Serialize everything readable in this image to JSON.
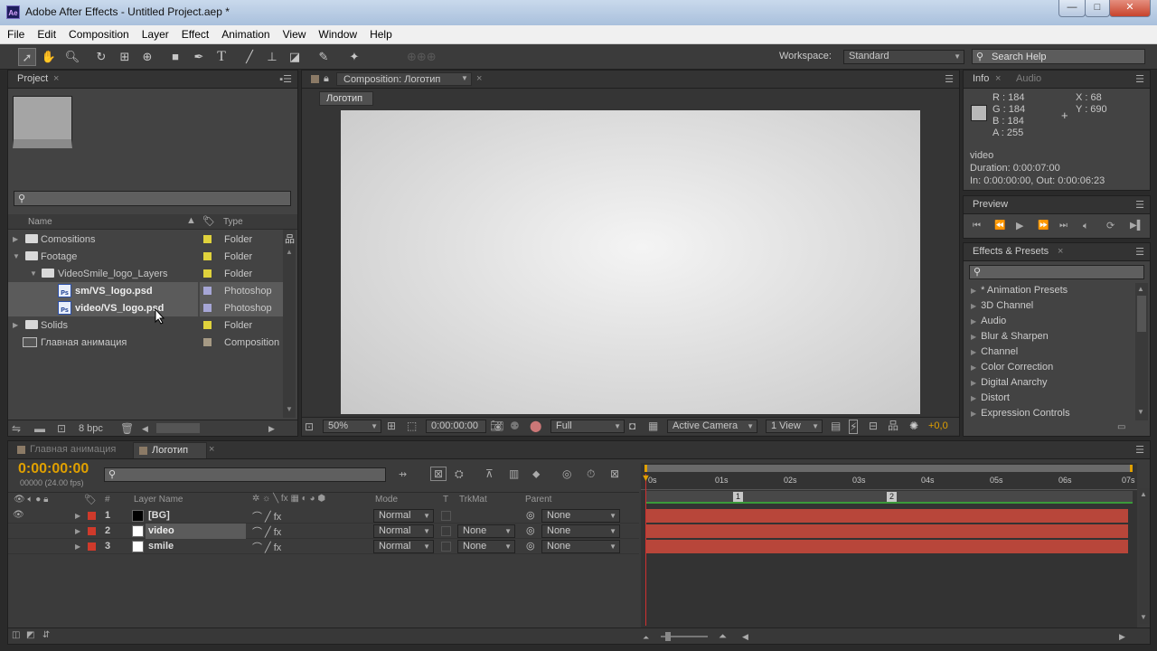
{
  "window": {
    "app_icon": "Ae",
    "title": "Adobe After Effects - Untitled Project.aep *",
    "min": "—",
    "max": "□",
    "close": "✕"
  },
  "menu": [
    "File",
    "Edit",
    "Composition",
    "Layer",
    "Effect",
    "Animation",
    "View",
    "Window",
    "Help"
  ],
  "toolbar": {
    "workspace_label": "Workspace:",
    "workspace_value": "Standard",
    "search_help": "Search Help"
  },
  "project": {
    "tab": "Project",
    "col_name": "Name",
    "col_type": "Type",
    "items": [
      {
        "name": "Comositions",
        "type": "Folder",
        "swatch": "#e0d23c"
      },
      {
        "name": "Footage",
        "type": "Folder",
        "swatch": "#e0d23c"
      },
      {
        "name": "VideoSmile_logo_Layers",
        "type": "Folder",
        "swatch": "#e0d23c"
      },
      {
        "name": "sm/VS_logo.psd",
        "type": "Photoshop",
        "swatch": "#a6a6d6"
      },
      {
        "name": "video/VS_logo.psd",
        "type": "Photoshop",
        "swatch": "#a6a6d6"
      },
      {
        "name": "Solids",
        "type": "Folder",
        "swatch": "#e0d23c"
      },
      {
        "name": "Главная анимация",
        "type": "Composition",
        "swatch": "#a69a85"
      }
    ],
    "bpc": "8 bpc"
  },
  "composition": {
    "tab": "Composition: Логотип",
    "sub_tab": "Логотип",
    "zoom": "50%",
    "timecode": "0:00:00:00",
    "resolution": "Full",
    "camera": "Active Camera",
    "view": "1 View",
    "exposure": "+0,0"
  },
  "info": {
    "tab": "Info",
    "tab2": "Audio",
    "r": "R : 184",
    "g": "G : 184",
    "b": "B : 184",
    "a": "A : 255",
    "x": "X : 68",
    "y": "Y : 690",
    "name": "video",
    "duration": "Duration: 0:00:07:00",
    "inout": "In: 0:00:00:00, Out: 0:00:06:23"
  },
  "preview": {
    "tab": "Preview"
  },
  "effects": {
    "tab": "Effects & Presets",
    "items": [
      "* Animation Presets",
      "3D Channel",
      "Audio",
      "Blur & Sharpen",
      "Channel",
      "Color Correction",
      "Digital Anarchy",
      "Distort",
      "Expression Controls"
    ]
  },
  "timeline": {
    "tab1": "Главная анимация",
    "tab2": "Логотип",
    "timecode": "0:00:00:00",
    "fps": "00000 (24.00 fps)",
    "cols": {
      "num": "#",
      "layer_name": "Layer Name",
      "mode": "Mode",
      "t": "T",
      "trkmat": "TrkMat",
      "parent": "Parent"
    },
    "layers": [
      {
        "num": "1",
        "name": "[BG]",
        "mode": "Normal",
        "trkmat": "",
        "parent": "None",
        "swatch": "#000000"
      },
      {
        "num": "2",
        "name": "video",
        "mode": "Normal",
        "trkmat": "None",
        "parent": "None",
        "swatch": "#ffffff"
      },
      {
        "num": "3",
        "name": "smile",
        "mode": "Normal",
        "trkmat": "None",
        "parent": "None",
        "swatch": "#ffffff"
      }
    ],
    "ruler": [
      "0s",
      "01s",
      "02s",
      "03s",
      "04s",
      "05s",
      "06s",
      "07s"
    ],
    "markers": [
      "1",
      "2"
    ]
  }
}
